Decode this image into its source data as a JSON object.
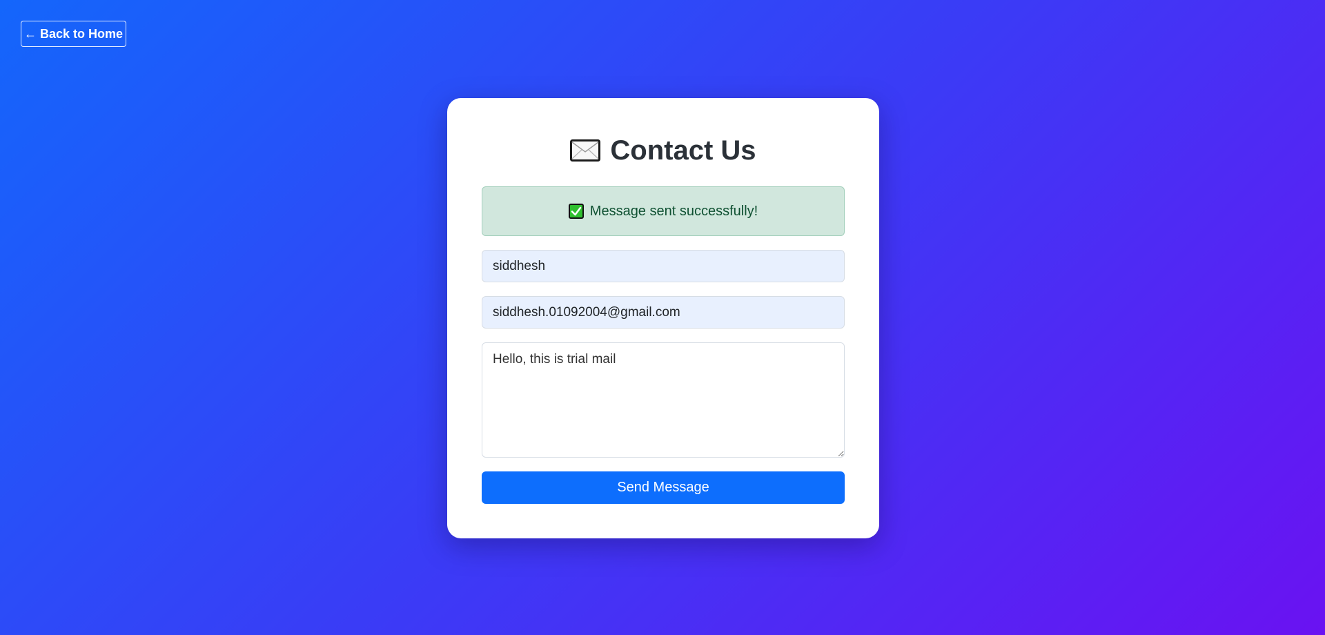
{
  "nav": {
    "back_label": "← Back to Home"
  },
  "contact": {
    "title": "Contact Us",
    "title_icon": "envelope-icon",
    "alert": {
      "icon": "check-mark-icon",
      "text": "Message sent successfully!"
    },
    "form": {
      "name_value": "siddhesh",
      "email_value": "siddhesh.01092004@gmail.com",
      "message_value": "Hello, this is trial mail",
      "send_label": "Send Message"
    }
  },
  "colors": {
    "background_start": "#1466fb",
    "background_end": "#6a12f2",
    "primary": "#0d6efd",
    "success_bg": "#d1e7dd",
    "success_text": "#0f5132",
    "title": "#2b3138"
  }
}
